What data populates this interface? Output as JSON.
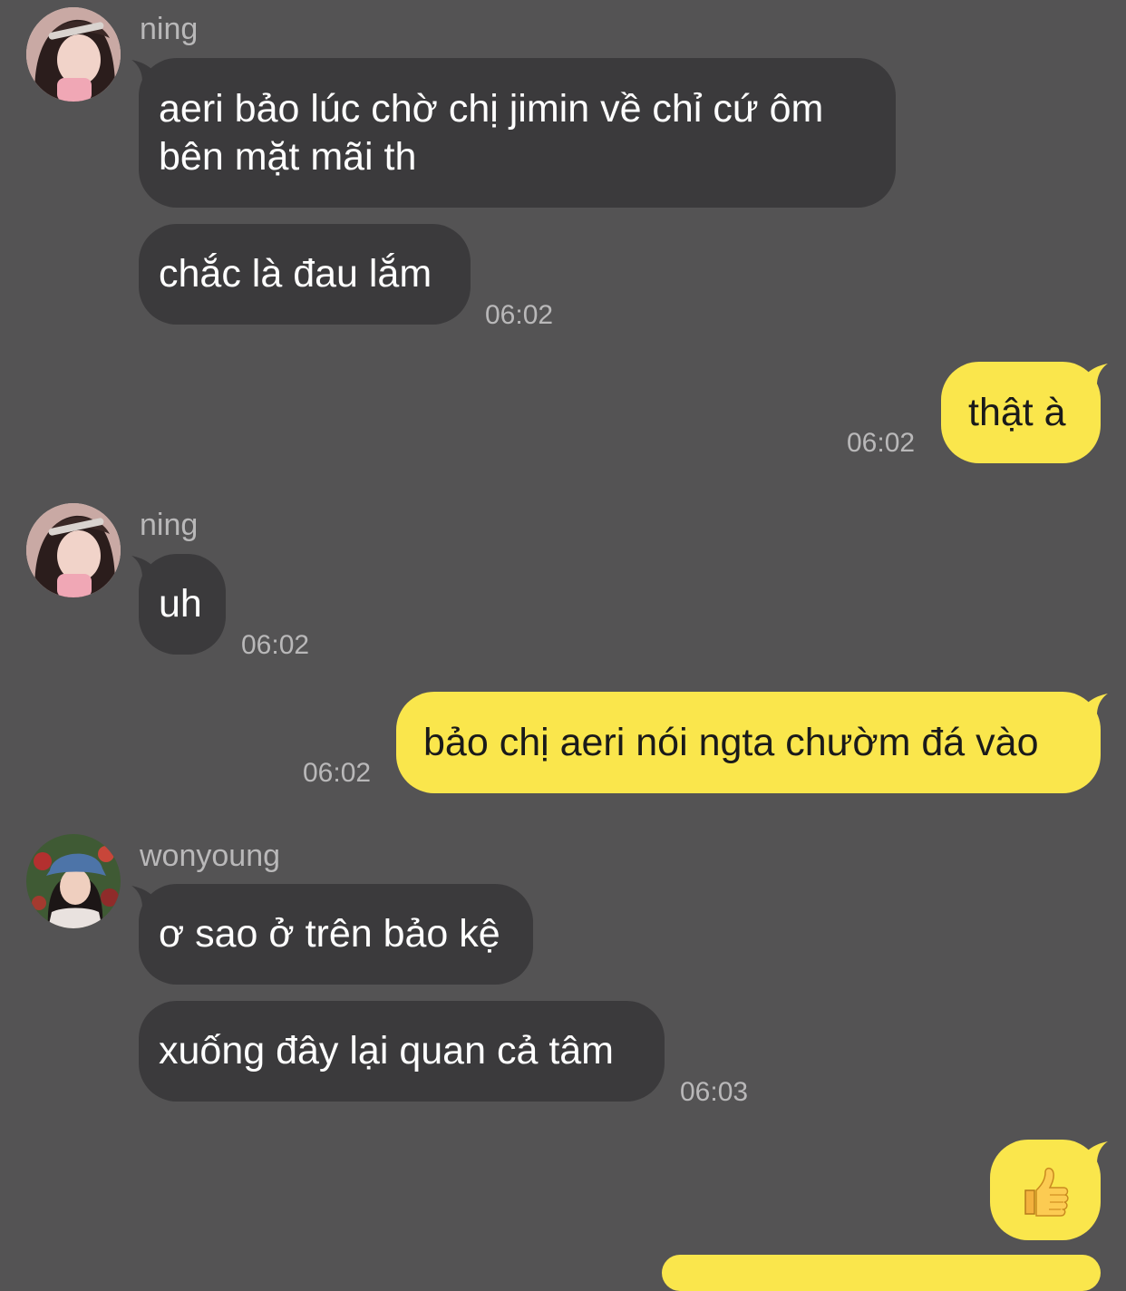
{
  "colors": {
    "background": "#545354",
    "incoming_bubble": "#3b3a3c",
    "outgoing_bubble": "#fae64c",
    "meta_text": "#b9b8b9"
  },
  "messages": [
    {
      "sender": "ning",
      "text_lines": [
        "aeri bảo lúc chờ chị jimin về chỉ cứ ôm",
        "bên mặt mãi th"
      ]
    },
    {
      "sender": "ning",
      "text": "chắc là đau lắm",
      "time": "06:02"
    },
    {
      "sender": "me",
      "text": "thật à",
      "time": "06:02"
    },
    {
      "sender": "ning",
      "text": "uh",
      "time": "06:02"
    },
    {
      "sender": "me",
      "text": "bảo chị aeri nói ngta chườm đá vào",
      "time": "06:02"
    },
    {
      "sender": "wonyoung",
      "text": "ơ sao ở trên bảo kệ"
    },
    {
      "sender": "wonyoung",
      "text": "xuống đây lại quan cả tâm",
      "time": "06:03"
    },
    {
      "sender": "me",
      "emoji": "thumbs-up-emoji"
    }
  ]
}
